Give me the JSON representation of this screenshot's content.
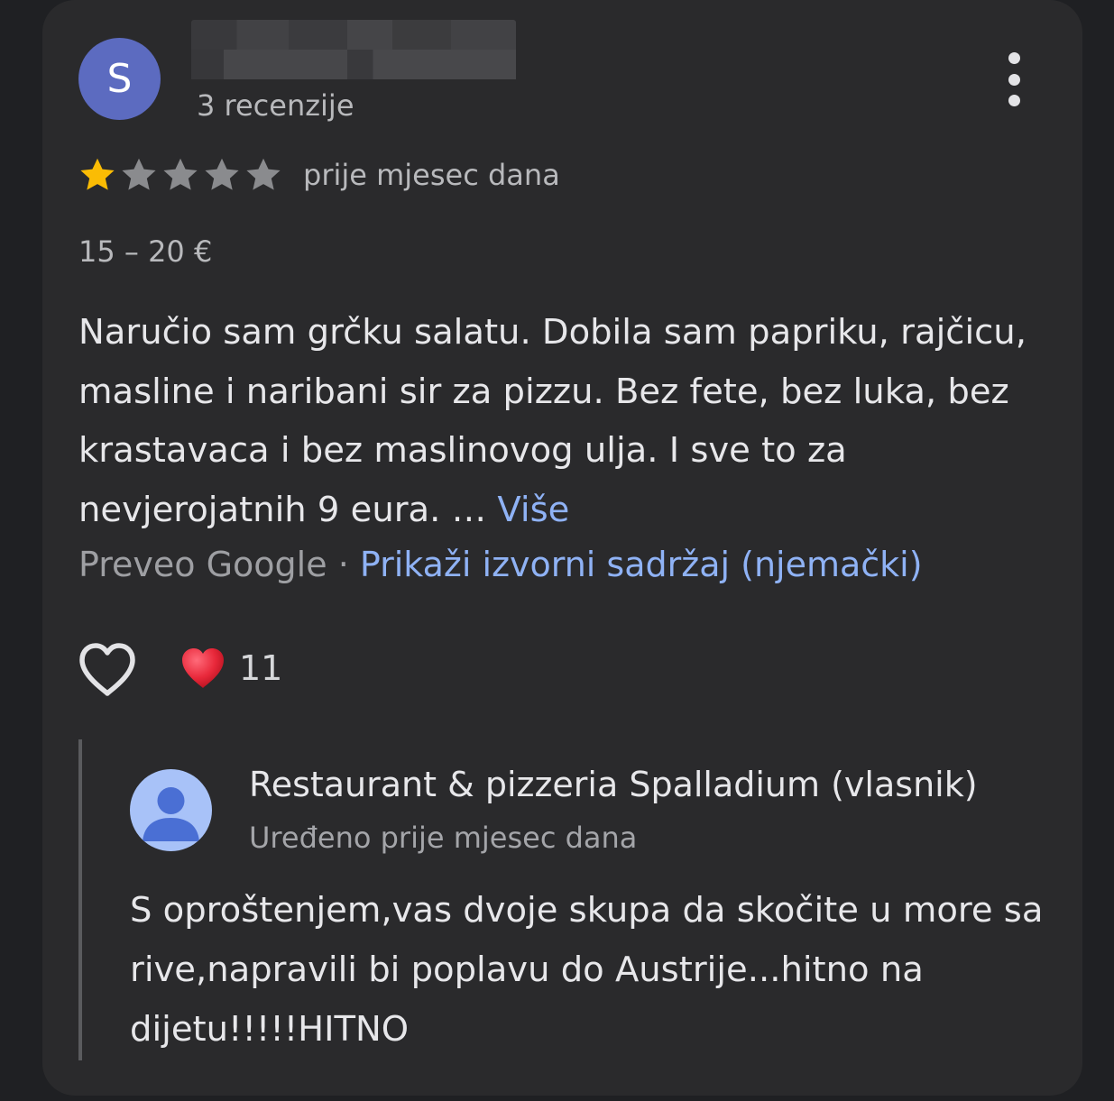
{
  "review": {
    "avatar_letter": "S",
    "avatar_color": "#5c6bc0",
    "review_count": "3 recenzije",
    "rating": 1,
    "max_rating": 5,
    "star_filled_color": "#fbbc04",
    "star_empty_color": "#8a8b8e",
    "time": "prije mjesec dana",
    "price": "15 – 20 €",
    "text": "Naručio sam grčku salatu. Dobila sam papriku, rajčicu, masline i naribani sir za pizzu. Bez fete, bez luka, bez krastavaca i bez maslinovog ulja. I sve to za nevjerojatnih 9 eura. … ",
    "more_label": "Više",
    "translated_by": "Preveo Google",
    "separator": " · ",
    "show_original_label": "Prikaži izvorni sadržaj (njemački)",
    "like_icon": "heart-outline-icon",
    "reaction_icon": "red-heart-icon",
    "reaction_count": "11",
    "link_color": "#8fb2f5",
    "menu_icon": "more-vertical-icon"
  },
  "owner_reply": {
    "avatar_icon": "person-icon",
    "name": "Restaurant & pizzeria Spalladium (vlasnik)",
    "time": "Uređeno prije mjesec dana",
    "text": "S oproštenjem,vas dvoje skupa da skočite u more sa rive,napravili bi poplavu do Austrije...hitno na dijetu!!!!!HITNO"
  }
}
